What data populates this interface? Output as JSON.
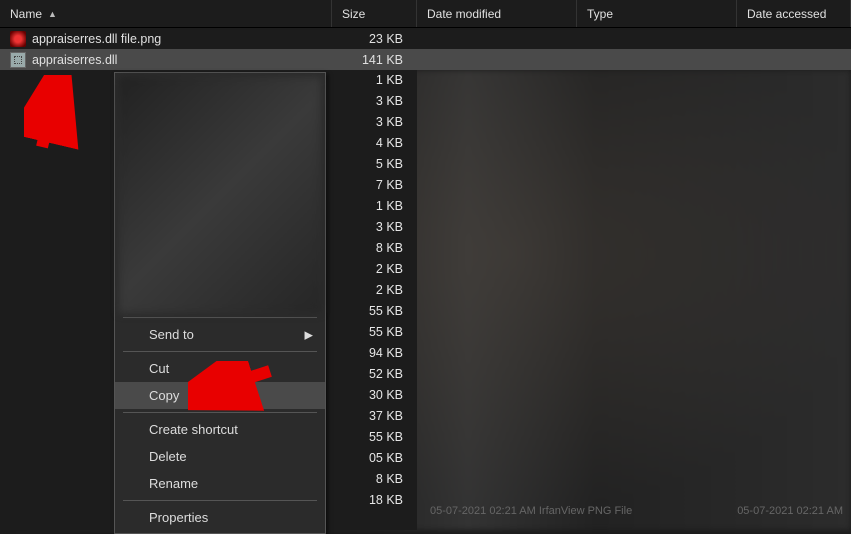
{
  "columns": {
    "name": "Name",
    "size": "Size",
    "date": "Date modified",
    "type": "Type",
    "accessed": "Date accessed"
  },
  "files": [
    {
      "name": "appraiserres.dll file.png",
      "size": "23 KB",
      "icon": "png"
    },
    {
      "name": "appraiserres.dll",
      "size": "141 KB",
      "icon": "dll",
      "selected": true
    }
  ],
  "side_sizes": [
    "1 KB",
    "3 KB",
    "3 KB",
    "4 KB",
    "5 KB",
    "7 KB",
    "1 KB",
    "3 KB",
    "8 KB",
    "2 KB",
    "2 KB",
    "55 KB",
    "55 KB",
    "94 KB",
    "52 KB",
    "30 KB",
    "37 KB",
    "55 KB",
    "05 KB",
    "8 KB",
    "18 KB"
  ],
  "context_menu": {
    "send_to": "Send to",
    "cut": "Cut",
    "copy": "Copy",
    "create_shortcut": "Create shortcut",
    "delete": "Delete",
    "rename": "Rename",
    "properties": "Properties"
  },
  "footer": {
    "left": "05-07-2021 02:21 AM    IrfanView PNG File",
    "right": "05-07-2021 02:21 AM"
  }
}
